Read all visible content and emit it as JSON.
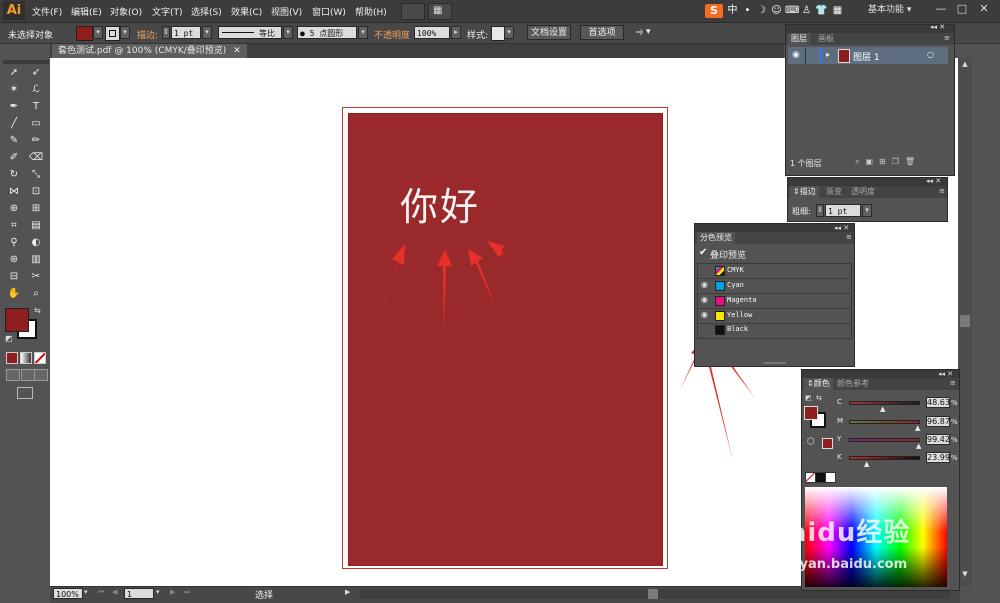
{
  "app": {
    "logo": "Ai"
  },
  "menu": [
    "文件(F)",
    "编辑(E)",
    "对象(O)",
    "文字(T)",
    "选择(S)",
    "效果(C)",
    "视图(V)",
    "窗口(W)",
    "帮助(H)"
  ],
  "ime": {
    "logo": "S",
    "mode": "中",
    "icons": [
      "•",
      "☽",
      "☺",
      "⌨",
      "♙",
      "👕",
      "▦"
    ]
  },
  "workspace": "基本功能",
  "window_controls": [
    "—",
    "□",
    "✕"
  ],
  "control_bar": {
    "selection_status": "未选择对象",
    "stroke_label": "描边:",
    "stroke_weight": "1 pt",
    "profile": "等比",
    "brush": "5 点圆形",
    "opacity_label": "不透明度",
    "opacity_value": "100%",
    "style_label": "样式:",
    "doc_setup": "文档设置",
    "preferences": "首选项"
  },
  "document_tab": "套色测试.pdf @ 100% (CMYK/叠印预览)",
  "artboard": {
    "text": "你好",
    "fill_color": "#99292a"
  },
  "status": {
    "zoom": "100%",
    "page": "1",
    "tool": "选择"
  },
  "layers_panel": {
    "tabs": [
      "图层",
      "画板"
    ],
    "layer_name": "图层 1",
    "footer": "1 个图层"
  },
  "stroke_panel": {
    "tabs": [
      "描边",
      "渐变",
      "透明度"
    ],
    "weight_label": "粗细:",
    "weight_value": "1 pt"
  },
  "separations_panel": {
    "title": "分色预览",
    "overprint_label": "叠印预览",
    "overprint_checked": true,
    "plates": [
      {
        "name": "CMYK",
        "color": "#8a8a8a",
        "visible": false
      },
      {
        "name": "Cyan",
        "color": "#00a3e0",
        "visible": true
      },
      {
        "name": "Magenta",
        "color": "#e0137f",
        "visible": true
      },
      {
        "name": "Yellow",
        "color": "#ffe600",
        "visible": true
      },
      {
        "name": "Black",
        "color": "#111111",
        "visible": false
      }
    ]
  },
  "color_panel": {
    "tabs": [
      "颜色",
      "颜色参考"
    ],
    "channels": [
      {
        "label": "C",
        "value": "48.63",
        "unit": "%",
        "fraction": 0.486
      },
      {
        "label": "M",
        "value": "96.87",
        "unit": "%",
        "fraction": 0.969
      },
      {
        "label": "Y",
        "value": "99.42",
        "unit": "%",
        "fraction": 0.994
      },
      {
        "label": "K",
        "value": "23.99",
        "unit": "%",
        "fraction": 0.24
      }
    ]
  },
  "watermark": {
    "brand": "Baidu经验",
    "url": "jingyan.baidu.com"
  },
  "colors": {
    "accent": "#f59b23",
    "fill": "#8f1f1f",
    "arrow": "#e8302a"
  }
}
